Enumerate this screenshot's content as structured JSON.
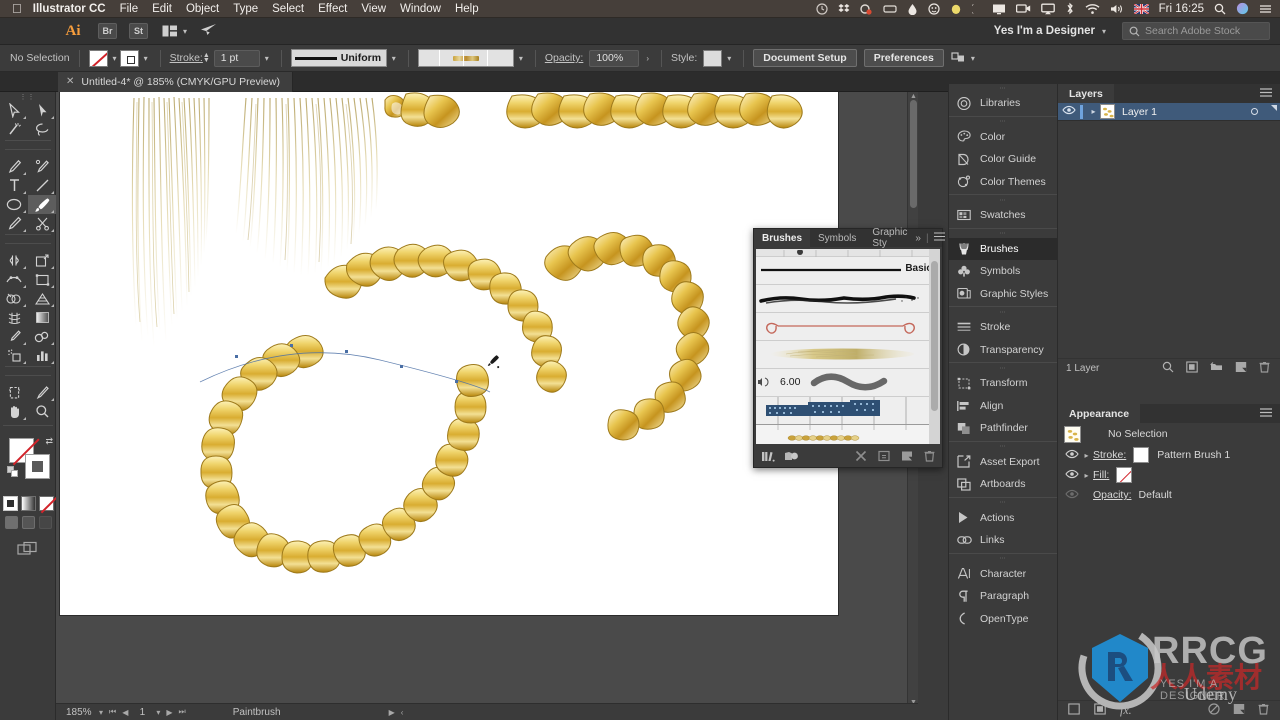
{
  "macbar": {
    "apple_icon": "apple-icon",
    "app_name": "Illustrator CC",
    "menus": [
      "File",
      "Edit",
      "Object",
      "Type",
      "Select",
      "Effect",
      "View",
      "Window",
      "Help"
    ],
    "clock": "Fri 16:25",
    "status_icons": [
      "timemachine-icon",
      "dropbox-icon",
      "creativecloud-icon",
      "display-capture-icon",
      "droplet-icon",
      "skitch-icon",
      "lemon-icon",
      "moon-icon",
      "monitor-icon",
      "camera-icon",
      "airplay-icon",
      "bluetooth-icon",
      "wifi-icon",
      "volume-icon",
      "uk-flag-icon",
      "spotlight-search-icon",
      "siri-icon",
      "notification-center-icon"
    ]
  },
  "appbar": {
    "logo": "Ai",
    "bridge_label": "Br",
    "stock_label": "St",
    "arrange_icon": "arrange-documents-icon",
    "screen_icon": "share-icon",
    "workspace": "Yes I'm a Designer",
    "workspace_caret": "chevron-down-icon",
    "search_placeholder": "Search Adobe Stock",
    "search_icon": "search-icon"
  },
  "control_bar": {
    "selection_status": "No Selection",
    "fill_swatch": "none-fill-swatch",
    "stroke_swatch": "square-stroke-swatch",
    "stroke_label": "Stroke:",
    "stroke_weight": "1 pt",
    "profile_label": "Uniform",
    "brush_definition": "gold-chain-pattern-brush",
    "opacity_label": "Opacity:",
    "opacity_value": "100%",
    "style_label": "Style:",
    "document_setup": "Document Setup",
    "preferences": "Preferences",
    "align_icon": "align-to-selection-icon"
  },
  "document_tab": {
    "close_icon": "close-icon",
    "title": "Untitled-4* @ 185% (CMYK/GPU Preview)"
  },
  "toolbar": {
    "tools": [
      {
        "name": "selection-tool",
        "selected": false
      },
      {
        "name": "direct-selection-tool",
        "selected": false
      },
      {
        "name": "magic-wand-tool",
        "selected": false
      },
      {
        "name": "lasso-tool",
        "selected": false
      },
      {
        "name": "pen-tool",
        "selected": false
      },
      {
        "name": "curvature-tool",
        "selected": false
      },
      {
        "name": "type-tool",
        "selected": false
      },
      {
        "name": "line-segment-tool",
        "selected": false
      },
      {
        "name": "ellipse-tool",
        "selected": false
      },
      {
        "name": "paintbrush-tool",
        "selected": true
      },
      {
        "name": "pencil-tool",
        "selected": false
      },
      {
        "name": "scissors-tool",
        "selected": false
      },
      {
        "name": "rotate-tool",
        "selected": false
      },
      {
        "name": "scale-tool",
        "selected": false
      },
      {
        "name": "width-tool",
        "selected": false
      },
      {
        "name": "free-transform-tool",
        "selected": false
      },
      {
        "name": "shape-builder-tool",
        "selected": false
      },
      {
        "name": "perspective-grid-tool",
        "selected": false
      },
      {
        "name": "mesh-tool",
        "selected": false
      },
      {
        "name": "gradient-tool",
        "selected": false
      },
      {
        "name": "eyedropper-tool",
        "selected": false
      },
      {
        "name": "blend-tool",
        "selected": false
      },
      {
        "name": "symbol-sprayer-tool",
        "selected": false
      },
      {
        "name": "column-graph-tool",
        "selected": false
      },
      {
        "name": "artboard-tool",
        "selected": false
      },
      {
        "name": "slice-tool",
        "selected": false
      },
      {
        "name": "hand-tool",
        "selected": false
      },
      {
        "name": "zoom-tool",
        "selected": false
      }
    ],
    "fill_swatch": "none-fill",
    "stroke_swatch": "white-stroke",
    "swap_icon": "swap-fill-stroke-icon",
    "default_icon": "default-fill-stroke-icon",
    "color_modes": [
      "color-mode",
      "gradient-mode",
      "none-mode"
    ],
    "draw_modes": [
      "draw-normal",
      "draw-behind",
      "draw-inside"
    ],
    "screen_mode": "change-screen-mode-icon"
  },
  "canvas": {
    "artwork_description": "gold-chain-artwork",
    "cursor": "paintbrush-cursor"
  },
  "brushes_panel": {
    "tabs": [
      {
        "label": "Brushes",
        "active": true
      },
      {
        "label": "Symbols",
        "active": false
      },
      {
        "label": "Graphic Sty",
        "active": false
      }
    ],
    "overflow_icon": "chevron-double-right-icon",
    "menu_icon": "panel-menu-icon",
    "brushes": [
      {
        "name": "basic-brush",
        "label": "Basic",
        "type": "plain-line"
      },
      {
        "name": "charcoal-brush",
        "label": "",
        "type": "charcoal-art-brush"
      },
      {
        "name": "arrow-brush",
        "label": "",
        "type": "arrow-pattern-brush"
      },
      {
        "name": "feather-brush",
        "label": "",
        "type": "feather-art-brush"
      },
      {
        "name": "bristle-brush",
        "label": "6.00",
        "type": "bristle-brush"
      },
      {
        "name": "scatter-brush",
        "label": "",
        "type": "pattern-brush-blue"
      },
      {
        "name": "pattern-brush-1",
        "label": "",
        "type": "gold-chain-pattern-brush",
        "selected": true
      }
    ],
    "footer_icons": [
      "brush-libraries-icon",
      "libraries-panel-icon",
      "remove-brush-stroke-icon",
      "options-of-selected-object-icon",
      "new-brush-icon",
      "delete-brush-icon"
    ]
  },
  "dock": {
    "groups": [
      {
        "items": [
          {
            "label": "Libraries",
            "icon": "creative-cloud-libraries-icon",
            "active": false
          }
        ]
      },
      {
        "items": [
          {
            "label": "Color",
            "icon": "color-palette-icon",
            "active": false
          },
          {
            "label": "Color Guide",
            "icon": "color-guide-icon",
            "active": false
          },
          {
            "label": "Color Themes",
            "icon": "color-themes-icon",
            "active": false
          }
        ]
      },
      {
        "items": [
          {
            "label": "Swatches",
            "icon": "swatches-icon",
            "active": false
          }
        ]
      },
      {
        "items": [
          {
            "label": "Brushes",
            "icon": "brushes-icon",
            "active": true
          },
          {
            "label": "Symbols",
            "icon": "symbols-icon",
            "active": false
          },
          {
            "label": "Graphic Styles",
            "icon": "graphic-styles-icon",
            "active": false
          }
        ]
      },
      {
        "items": [
          {
            "label": "Stroke",
            "icon": "stroke-icon",
            "active": false
          },
          {
            "label": "Transparency",
            "icon": "transparency-icon",
            "active": false
          }
        ]
      },
      {
        "items": [
          {
            "label": "Transform",
            "icon": "transform-icon",
            "active": false
          },
          {
            "label": "Align",
            "icon": "align-icon",
            "active": false
          },
          {
            "label": "Pathfinder",
            "icon": "pathfinder-icon",
            "active": false
          }
        ]
      },
      {
        "items": [
          {
            "label": "Asset Export",
            "icon": "asset-export-icon",
            "active": false
          },
          {
            "label": "Artboards",
            "icon": "artboards-icon",
            "active": false
          }
        ]
      },
      {
        "items": [
          {
            "label": "Actions",
            "icon": "actions-play-icon",
            "active": false
          },
          {
            "label": "Links",
            "icon": "links-icon",
            "active": false
          }
        ]
      },
      {
        "items": [
          {
            "label": "Character",
            "icon": "character-icon",
            "active": false
          },
          {
            "label": "Paragraph",
            "icon": "paragraph-icon",
            "active": false
          },
          {
            "label": "OpenType",
            "icon": "opentype-icon",
            "active": false
          }
        ]
      }
    ]
  },
  "layers_panel": {
    "tab_label": "Layers",
    "menu_icon": "panel-menu-icon",
    "rows": [
      {
        "name": "Layer 1",
        "visible": true,
        "eye_icon": "eye-icon",
        "twirl_icon": "chevron-right-icon",
        "target_icon": "target-circle-icon"
      }
    ],
    "footer_count": "1 Layer",
    "footer_icons": [
      "locate-object-icon",
      "make-clipping-mask-icon",
      "create-new-sublayer-icon",
      "create-new-layer-icon",
      "delete-selection-icon"
    ]
  },
  "appearance_panel": {
    "tab_label": "Appearance",
    "menu_icon": "panel-menu-icon",
    "object_label": "No Selection",
    "rows": [
      {
        "label": "Stroke:",
        "value": "Pattern Brush 1",
        "eye_icon": "eye-icon",
        "twirl_icon": "chevron-right-icon",
        "swatch": "white-swatch"
      },
      {
        "label": "Fill:",
        "value": "",
        "eye_icon": "eye-icon",
        "twirl_icon": "chevron-right-icon",
        "swatch": "none-swatch"
      },
      {
        "label": "Opacity:",
        "value": "Default",
        "eye_icon": "eye-dim-icon",
        "twirl_icon": "",
        "swatch": ""
      }
    ],
    "footer_icons": [
      "add-new-stroke-icon",
      "add-new-fill-icon",
      "add-new-effect-icon",
      "clear-appearance-icon",
      "duplicate-item-icon",
      "delete-item-icon"
    ]
  },
  "status_bar": {
    "zoom": "185%",
    "zoom_caret": "chevron-down-icon",
    "first_icon": "first-artboard-icon",
    "prev_icon": "previous-artboard-icon",
    "artboard_number": "1",
    "artboard_caret": "chevron-down-icon",
    "next_icon": "next-artboard-icon",
    "last_icon": "last-artboard-icon",
    "current_tool": "Paintbrush",
    "status_menu_icon": "status-menu-icon"
  },
  "watermark": {
    "brand": "RRCG",
    "chinese": "人人素材",
    "sub": "YES I'M A DESIGNER",
    "platform": "Udemy"
  }
}
